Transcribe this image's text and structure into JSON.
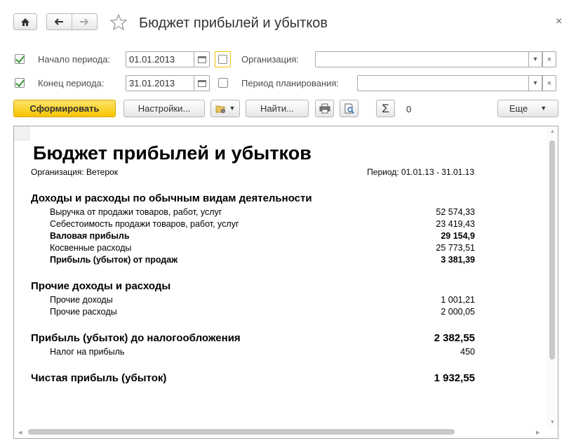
{
  "window": {
    "title": "Бюджет прибылей и убытков",
    "close_glyph": "×"
  },
  "filters": {
    "start": {
      "label": "Начало периода:",
      "value": "01.01.2013",
      "checked": true
    },
    "end": {
      "label": "Конец периода:",
      "value": "31.01.2013",
      "checked": true
    },
    "organization": {
      "label": "Организация:",
      "value": ""
    },
    "planning_period": {
      "label": "Период планирования:",
      "value": ""
    }
  },
  "toolbar": {
    "generate": "Сформировать",
    "settings": "Настройки...",
    "find": "Найти...",
    "sum_value": "0",
    "more": "Еще"
  },
  "report": {
    "title": "Бюджет прибылей и убытков",
    "organization": "Организация: Ветерок",
    "period": "Период: 01.01.13 - 31.01.13",
    "section1": {
      "title": "Доходы и расходы по обычным видам деятельности",
      "rows": [
        {
          "label": "Выручка от продажи товаров, работ, услуг",
          "value": "52 574,33"
        },
        {
          "label": "Себестоимость продажи товаров, работ, услуг",
          "value": "23 419,43"
        },
        {
          "label": "Валовая прибыль",
          "value": "29 154,9"
        },
        {
          "label": "Косвенные расходы",
          "value": "25 773,51"
        },
        {
          "label": "Прибыль (убыток) от продаж",
          "value": "3 381,39"
        }
      ]
    },
    "section2": {
      "title": "Прочие доходы и расходы",
      "rows": [
        {
          "label": "Прочие доходы",
          "value": "1 001,21"
        },
        {
          "label": "Прочие расходы",
          "value": "2 000,05"
        }
      ]
    },
    "pretax": {
      "label": "Прибыль (убыток) до налогообложения",
      "value": "2 382,55"
    },
    "tax": {
      "label": "Налог на прибыль",
      "value": "450"
    },
    "net": {
      "label": "Чистая прибыль (убыток)",
      "value": "1 932,55"
    }
  },
  "icons": {
    "home": "home-icon",
    "back": "arrow-left-icon",
    "forward": "arrow-right-icon",
    "favorite": "star-icon",
    "calendar": "calendar-icon",
    "print": "printer-icon",
    "preview": "print-preview-icon",
    "sum": "sigma-icon",
    "variants": "folder-gear-icon"
  },
  "colors": {
    "primary_button": "#f5c400",
    "checkbox_check": "#2e9a2e",
    "focused_checkbox": "#f0c000"
  }
}
